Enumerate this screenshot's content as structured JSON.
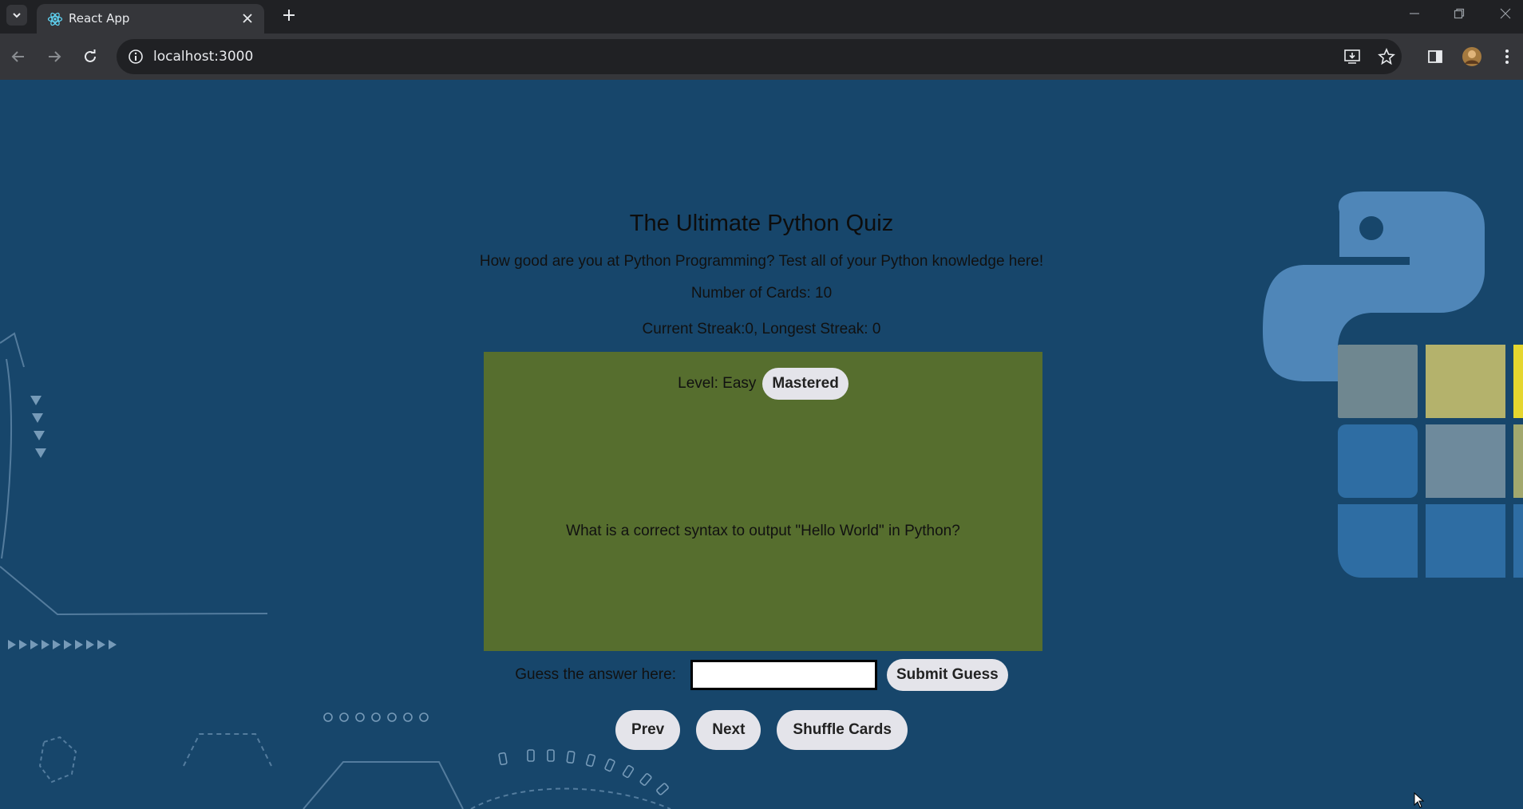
{
  "browser": {
    "tab_title": "React App",
    "url": "localhost:3000"
  },
  "quiz": {
    "title": "The Ultimate Python Quiz",
    "subtitle": "How good are you at Python Programming? Test all of your Python knowledge here!",
    "card_count_text": "Number of Cards: 10",
    "streak_text": "Current Streak:0, Longest Streak: 0"
  },
  "card": {
    "level_text": "Level: Easy",
    "mastered_label": "Mastered",
    "question": "What is a correct syntax to output \"Hello World\" in Python?",
    "color": "#566e2e"
  },
  "guess": {
    "label": "Guess the answer here:",
    "value": "",
    "submit_label": "Submit Guess"
  },
  "navigation": {
    "prev_label": "Prev",
    "next_label": "Next",
    "shuffle_label": "Shuffle Cards"
  },
  "colors": {
    "background": "#17466b",
    "button_bg": "#e4e4ea"
  }
}
